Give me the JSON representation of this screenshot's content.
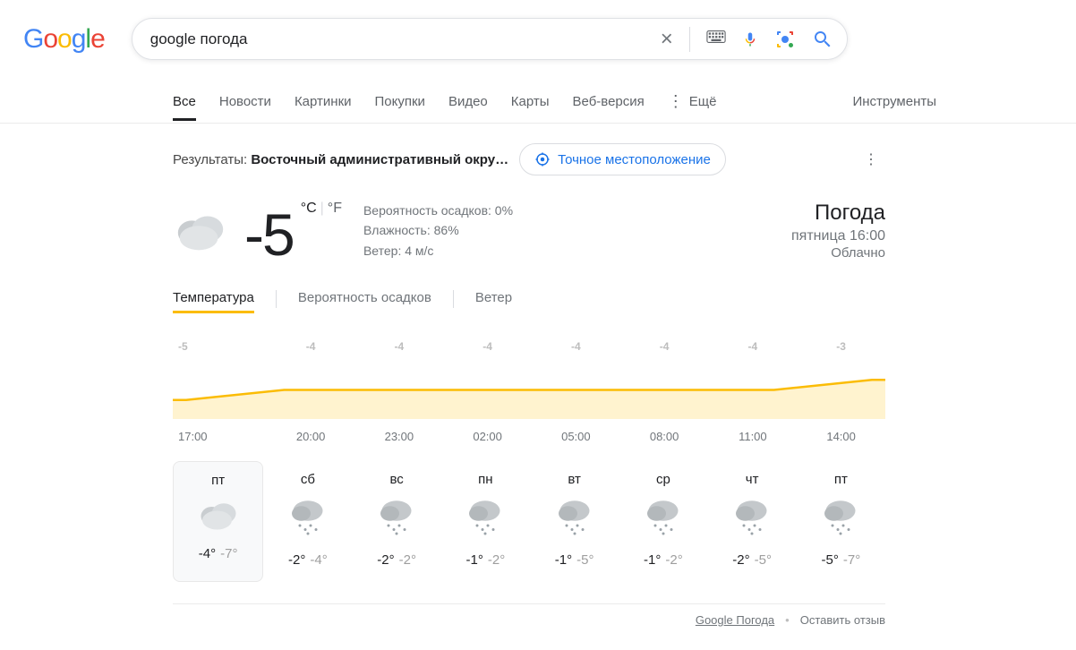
{
  "search": {
    "query": "google погода"
  },
  "tabs": [
    "Все",
    "Новости",
    "Картинки",
    "Покупки",
    "Видео",
    "Карты",
    "Веб-версия"
  ],
  "more_label": "Ещё",
  "tools_label": "Инструменты",
  "location": {
    "prefix": "Результаты: ",
    "place": "Восточный административный окру…",
    "precise_btn": "Точное местоположение"
  },
  "weather": {
    "temp": "-5",
    "unit_c": "°C",
    "unit_f": "°F",
    "precip_label": "Вероятность осадков: 0%",
    "humidity_label": "Влажность: 86%",
    "wind_label": "Ветер: 4 м/с",
    "title": "Погода",
    "daytime": "пятница 16:00",
    "condition": "Облачно"
  },
  "subtabs": [
    "Температура",
    "Вероятность осадков",
    "Ветер"
  ],
  "chart_data": {
    "type": "area",
    "title": "Температура",
    "xlabel": "",
    "ylabel": "°C",
    "x": [
      "17:00",
      "20:00",
      "23:00",
      "02:00",
      "05:00",
      "08:00",
      "11:00",
      "14:00"
    ],
    "values": [
      -5,
      -4,
      -4,
      -4,
      -4,
      -4,
      -4,
      -3
    ],
    "ylim": [
      -6,
      -2
    ]
  },
  "forecast": [
    {
      "day": "пт",
      "icon": "cloudy",
      "hi": "-4°",
      "lo": "-7°"
    },
    {
      "day": "сб",
      "icon": "snow",
      "hi": "-2°",
      "lo": "-4°"
    },
    {
      "day": "вс",
      "icon": "snow",
      "hi": "-2°",
      "lo": "-2°"
    },
    {
      "day": "пн",
      "icon": "snow",
      "hi": "-1°",
      "lo": "-2°"
    },
    {
      "day": "вт",
      "icon": "snow",
      "hi": "-1°",
      "lo": "-5°"
    },
    {
      "day": "ср",
      "icon": "snow",
      "hi": "-1°",
      "lo": "-2°"
    },
    {
      "day": "чт",
      "icon": "snow",
      "hi": "-2°",
      "lo": "-5°"
    },
    {
      "day": "пт",
      "icon": "snow",
      "hi": "-5°",
      "lo": "-7°"
    }
  ],
  "footer": {
    "source": "Google Погода",
    "feedback": "Оставить отзыв"
  }
}
